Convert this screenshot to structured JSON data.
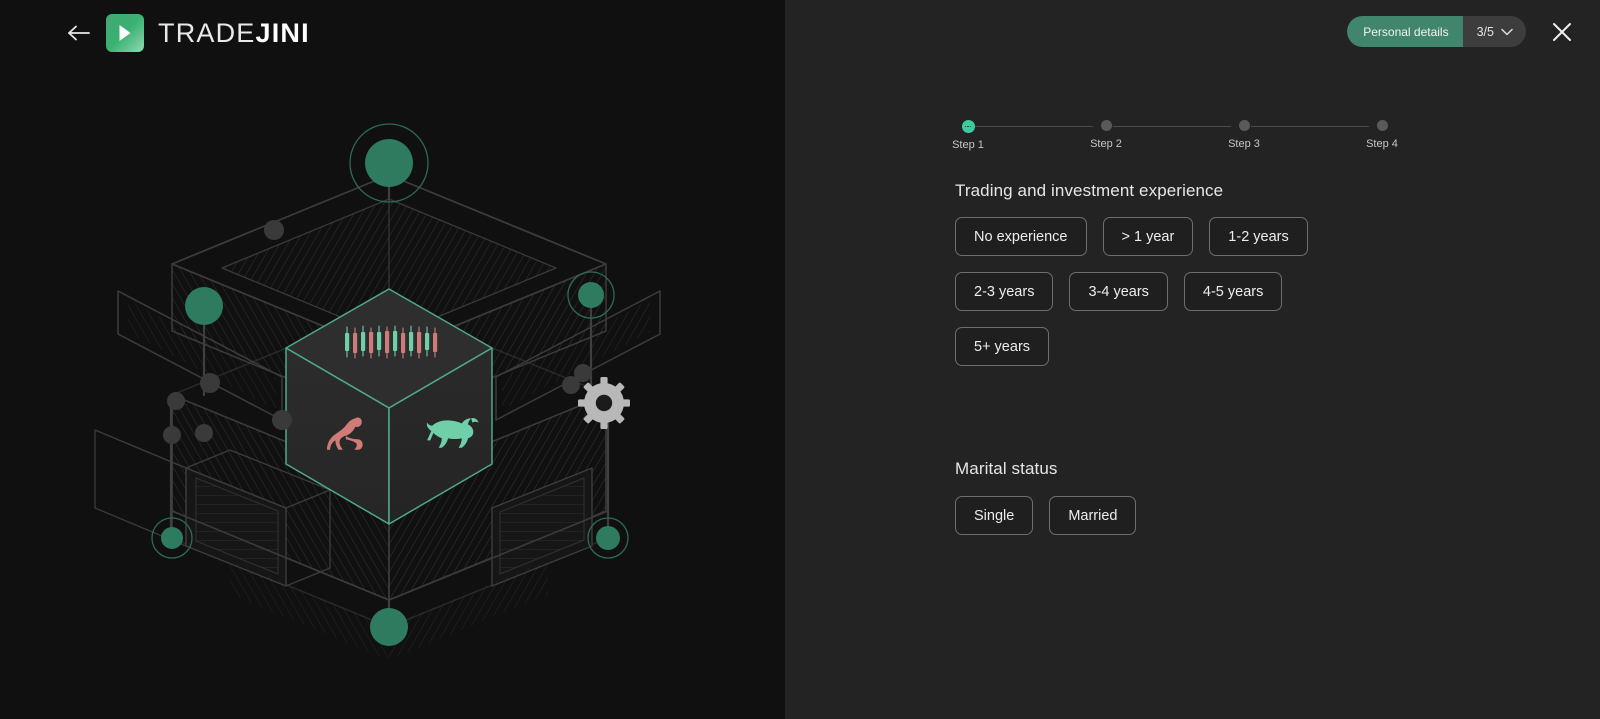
{
  "brand": {
    "name_light": "TRADE",
    "name_bold": "JINI",
    "back_icon": "back-arrow-icon",
    "logo_icon": "tradejini-logo-icon"
  },
  "topbar": {
    "pill_label": "Personal details",
    "pill_count": "3/5",
    "chevron_icon": "chevron-down-icon",
    "close_icon": "close-icon"
  },
  "stepper": {
    "steps": [
      {
        "label": "Step 1",
        "active": true
      },
      {
        "label": "Step 2",
        "active": false
      },
      {
        "label": "Step 3",
        "active": false
      },
      {
        "label": "Step 4",
        "active": false
      }
    ]
  },
  "experience": {
    "title": "Trading and investment experience",
    "options": [
      "No experience",
      "> 1 year",
      "1-2 years",
      "2-3 years",
      "3-4 years",
      "4-5 years",
      "5+ years"
    ]
  },
  "marital": {
    "title": "Marital status",
    "options": [
      "Single",
      "Married"
    ]
  },
  "illustration": {
    "name": "isometric-trading-cube-illustration",
    "elements": [
      "candlestick-chart",
      "bear-icon",
      "bull-icon",
      "gear-icon"
    ]
  },
  "colors": {
    "accent_green": "#3ecba0",
    "pill_green": "#40856c",
    "bear_red": "#cf7b77",
    "bull_green": "#6fcfa8",
    "left_bg": "#101010",
    "right_bg": "#232323"
  }
}
